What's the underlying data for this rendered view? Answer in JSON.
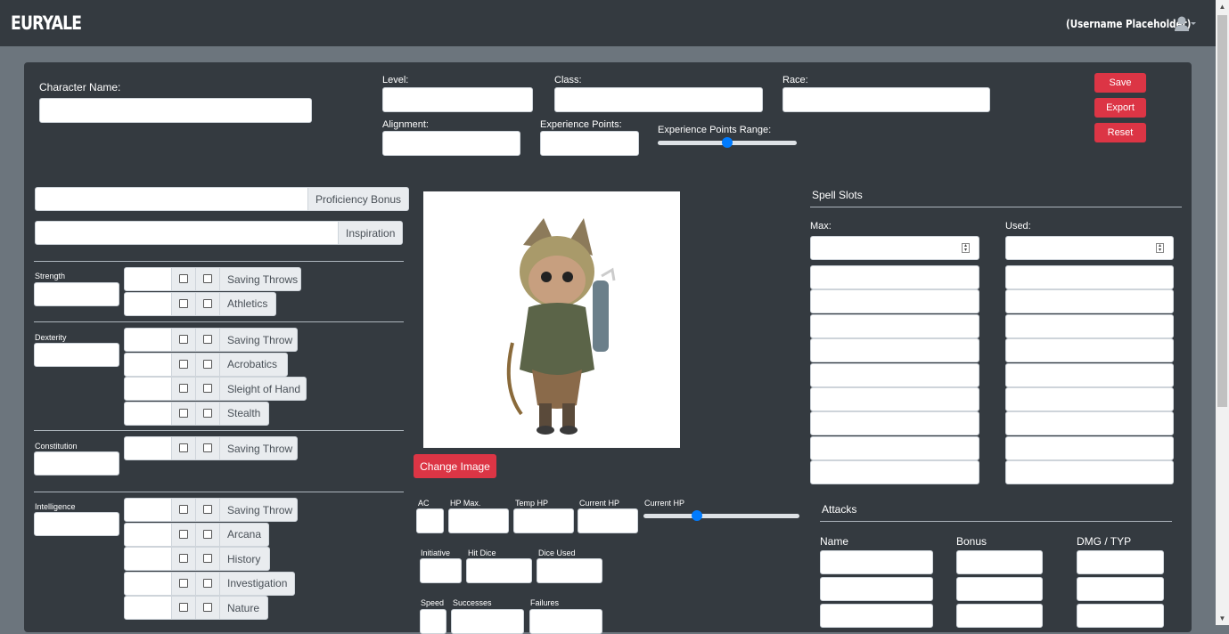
{
  "navbar": {
    "brand": "EURYALE",
    "username": "(Username Placeholder)",
    "user_icon": "user-icon",
    "caret_icon": "caret-down-icon",
    "accent": "#28a745"
  },
  "header": {
    "character_name_label": "Character Name:",
    "level_label": "Level:",
    "class_label": "Class:",
    "race_label": "Race:",
    "alignment_label": "Alignment:",
    "xp_label": "Experience Points:",
    "xp_range_label": "Experience Points Range:",
    "xp_range_value": 0.5
  },
  "actions": {
    "save": "Save",
    "export": "Export",
    "reset": "Reset",
    "button_color": "#dc3545"
  },
  "proficiency": {
    "proficiency_bonus": "Proficiency Bonus",
    "inspiration": "Inspiration"
  },
  "abilities": [
    {
      "name": "Strength",
      "skills": [
        "Saving Throws",
        "Athletics"
      ]
    },
    {
      "name": "Dexterity",
      "skills": [
        "Saving Throw",
        "Acrobatics",
        "Sleight of Hand",
        "Stealth"
      ]
    },
    {
      "name": "Constitution",
      "skills": [
        "Saving Throw"
      ]
    },
    {
      "name": "Intelligence",
      "skills": [
        "Saving Throw",
        "Arcana",
        "History",
        "Investigation",
        "Nature"
      ]
    }
  ],
  "portrait": {
    "change_image": "Change Image"
  },
  "combat": {
    "ac": "AC",
    "hp_max": "HP Max.",
    "temp_hp": "Temp HP",
    "current_hp": "Current HP",
    "current_hp_range": "Current HP",
    "current_hp_range_value": 0.34,
    "initiative": "Initiative",
    "hit_dice": "Hit Dice",
    "dice_used": "Dice Used",
    "speed": "Speed",
    "successes": "Successes",
    "failures": "Failures"
  },
  "spell_slots": {
    "title": "Spell Slots",
    "max_label": "Max:",
    "used_label": "Used:"
  },
  "attacks": {
    "title": "Attacks",
    "name_label": "Name",
    "bonus_label": "Bonus",
    "dmg_label": "DMG / TYP"
  }
}
